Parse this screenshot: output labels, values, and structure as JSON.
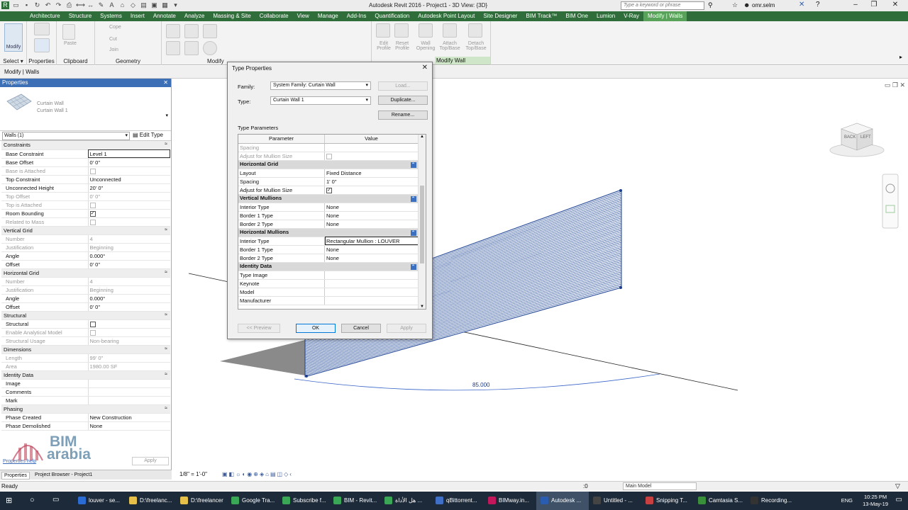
{
  "title_bar": {
    "app_title": "Autodesk Revit 2016 -    Project1 - 3D View: {3D}",
    "search_placeholder": "Type a keyword or phrase",
    "user": "omr.selm"
  },
  "ribbon_tabs": [
    "Architecture",
    "Structure",
    "Systems",
    "Insert",
    "Annotate",
    "Analyze",
    "Massing & Site",
    "Collaborate",
    "View",
    "Manage",
    "Add-Ins",
    "Quantification",
    "Autodesk Point Layout",
    "Site Designer",
    "BIM Track™",
    "BIM One",
    "Lumion",
    "V-Ray",
    "Modify | Walls"
  ],
  "ribbon_panels": {
    "modify_label": "Modify",
    "select": "Select ▾",
    "properties": "Properties",
    "clipboard": "Clipboard",
    "geometry": "Geometry",
    "modify": "Modify",
    "modify_walls": "Modify Wall",
    "paste": "Paste",
    "cope": "Cope",
    "cut": "Cut",
    "join": "Join",
    "edit_profile": "Edit Profile",
    "reset_profile": "Reset Profile",
    "wall_opening": "Wall Opening",
    "attach_top_base": "Attach Top/Base",
    "detach_top_base": "Detach Top/Base"
  },
  "options_bar": {
    "context": "Modify | Walls"
  },
  "properties": {
    "header": "Properties",
    "family_name": "Curtain Wall",
    "type_name": "Curtain Wall 1",
    "instance_selector": "Walls (1)",
    "edit_type": "Edit Type",
    "rows": [
      {
        "group": "Constraints"
      },
      {
        "label": "Base Constraint",
        "value": "Level 1"
      },
      {
        "label": "Base Offset",
        "value": "0'  0\""
      },
      {
        "label": "Base is Attached",
        "value": "",
        "dim": true,
        "check": "off"
      },
      {
        "label": "Top Constraint",
        "value": "Unconnected"
      },
      {
        "label": "Unconnected Height",
        "value": "20'  0\""
      },
      {
        "label": "Top Offset",
        "value": "0'  0\"",
        "dim": true
      },
      {
        "label": "Top is Attached",
        "value": "",
        "dim": true,
        "check": "off"
      },
      {
        "label": "Room Bounding",
        "value": "",
        "check": "on"
      },
      {
        "label": "Related to Mass",
        "value": "",
        "dim": true,
        "check": "off"
      },
      {
        "group": "Vertical Grid"
      },
      {
        "label": "Number",
        "value": "4",
        "dim": true
      },
      {
        "label": "Justification",
        "value": "Beginning",
        "dim": true
      },
      {
        "label": "Angle",
        "value": "0.000°"
      },
      {
        "label": "Offset",
        "value": "0'  0\""
      },
      {
        "group": "Horizontal Grid"
      },
      {
        "label": "Number",
        "value": "4",
        "dim": true
      },
      {
        "label": "Justification",
        "value": "Beginning",
        "dim": true
      },
      {
        "label": "Angle",
        "value": "0.000°"
      },
      {
        "label": "Offset",
        "value": "0'  0\""
      },
      {
        "group": "Structural"
      },
      {
        "label": "Structural",
        "value": "",
        "check": "off2"
      },
      {
        "label": "Enable Analytical Model",
        "value": "",
        "dim": true,
        "check": "off"
      },
      {
        "label": "Structural Usage",
        "value": "Non-bearing",
        "dim": true
      },
      {
        "group": "Dimensions"
      },
      {
        "label": "Length",
        "value": "99'  0\"",
        "dim": true
      },
      {
        "label": "Area",
        "value": "1980.00 SF",
        "dim": true
      },
      {
        "group": "Identity Data"
      },
      {
        "label": "Image",
        "value": ""
      },
      {
        "label": "Comments",
        "value": ""
      },
      {
        "label": "Mark",
        "value": ""
      },
      {
        "group": "Phasing"
      },
      {
        "label": "Phase Created",
        "value": "New Construction"
      },
      {
        "label": "Phase Demolished",
        "value": "None"
      }
    ],
    "help_link": "Properties help",
    "apply": "Apply",
    "tab_properties": "Properties",
    "tab_browser": "Project Browser - Project1"
  },
  "watermark": {
    "line1": "BIM",
    "line2": "arabia"
  },
  "dialog": {
    "title": "Type Properties",
    "family_label": "Family:",
    "family_value": "System Family: Curtain Wall",
    "type_label": "Type:",
    "type_value": "Curtain Wall 1",
    "load": "Load...",
    "duplicate": "Duplicate...",
    "rename": "Rename...",
    "type_parameters": "Type Parameters",
    "col_parameter": "Parameter",
    "col_value": "Value",
    "rows": [
      {
        "label": "Spacing",
        "value": "",
        "dim": true
      },
      {
        "label": "Adjust for Mullion Size",
        "value": "",
        "dim": true,
        "check": "off"
      },
      {
        "group": "Horizontal Grid"
      },
      {
        "label": "Layout",
        "value": "Fixed Distance"
      },
      {
        "label": "Spacing",
        "value": "1'  0\""
      },
      {
        "label": "Adjust for Mullion Size",
        "value": "",
        "check": "on"
      },
      {
        "group": "Vertical Mullions"
      },
      {
        "label": "Interior Type",
        "value": "None"
      },
      {
        "label": "Border 1 Type",
        "value": "None"
      },
      {
        "label": "Border 2 Type",
        "value": "None"
      },
      {
        "group": "Horizontal Mullions"
      },
      {
        "label": "Interior Type",
        "value": "Rectangular Mullion : LOUVER",
        "edit": true
      },
      {
        "label": "Border 1 Type",
        "value": "None"
      },
      {
        "label": "Border 2 Type",
        "value": "None"
      },
      {
        "group": "Identity Data"
      },
      {
        "label": "Type Image",
        "value": ""
      },
      {
        "label": "Keynote",
        "value": ""
      },
      {
        "label": "Model",
        "value": ""
      },
      {
        "label": "Manufacturer",
        "value": ""
      }
    ],
    "preview": "<< Preview",
    "ok": "OK",
    "cancel": "Cancel",
    "apply": "Apply"
  },
  "viewport": {
    "dimension": "85.000",
    "viewcube_front": "BACK",
    "viewcube_side": "LEFT"
  },
  "view_bar": {
    "scale": "1/8\" = 1'-0\""
  },
  "status_bar": {
    "status": "Ready",
    "zero": ":0",
    "model": "Main Model"
  },
  "taskbar": {
    "items": [
      {
        "label": "louver - se...",
        "color": "#2b6cd4"
      },
      {
        "label": "D:\\freelanc...",
        "color": "#e7c04a"
      },
      {
        "label": "D:\\freelancer",
        "color": "#e7c04a"
      },
      {
        "label": "Google Tra...",
        "color": "#3aa757"
      },
      {
        "label": "Subscribe f...",
        "color": "#3aa757"
      },
      {
        "label": "BIM - Revit...",
        "color": "#3aa757"
      },
      {
        "label": "هل الأداة ...",
        "color": "#3aa757"
      },
      {
        "label": "qBittorrent...",
        "color": "#3f6fc6"
      },
      {
        "label": "BIMway.in...",
        "color": "#c2185b"
      },
      {
        "label": "Autodesk ...",
        "color": "#2a5db0"
      },
      {
        "label": "Untitled - ...",
        "color": "#444444"
      },
      {
        "label": "Snipping T...",
        "color": "#c84040"
      },
      {
        "label": "Camtasia S...",
        "color": "#3a8f3a"
      },
      {
        "label": "Recording...",
        "color": "#333333"
      }
    ],
    "lang": "ENG",
    "time": "10:25 PM",
    "date": "13-May-19"
  },
  "colors": {
    "ribbon_green": "#2f6e3a",
    "active_tab": "#59a25a",
    "panel_blue": "#3c6fb6"
  }
}
